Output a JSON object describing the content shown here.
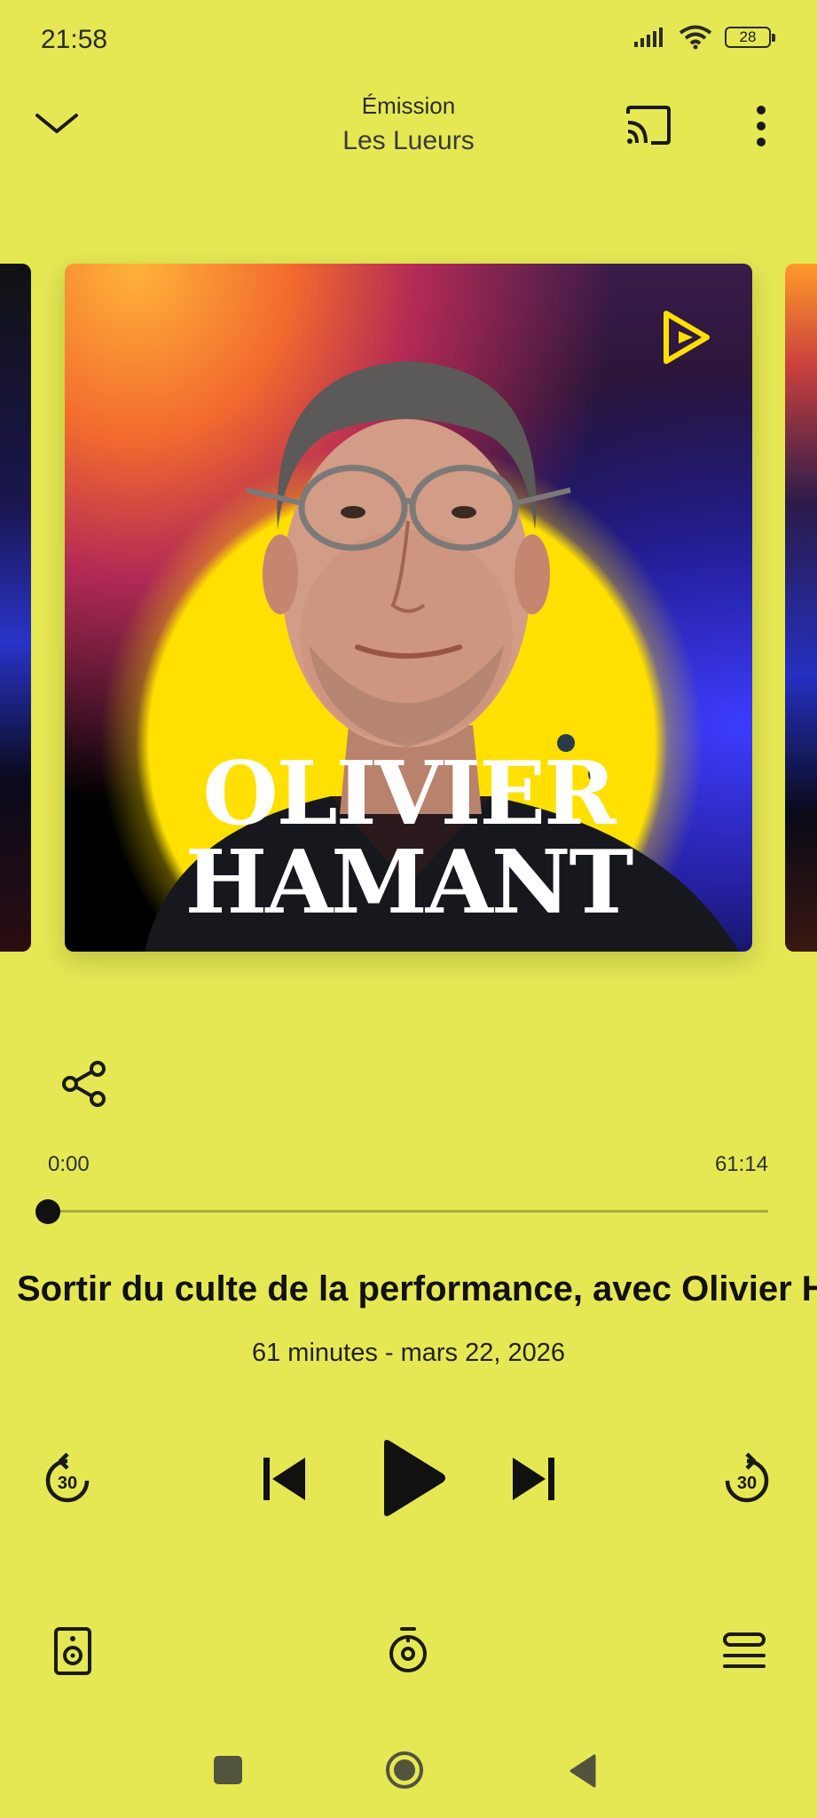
{
  "status_bar": {
    "time": "21:58",
    "battery": "28",
    "icons": [
      "signal-icon",
      "wifi-icon",
      "battery-icon"
    ]
  },
  "header": {
    "subtitle": "Émission",
    "title": "Les Lueurs",
    "icons": [
      "chevron-down-icon",
      "cast-icon",
      "more-vert-icon"
    ]
  },
  "artwork": {
    "name_line1": "OLIVIER",
    "name_line2": "HAMANT",
    "colors": {
      "circle": "#ffe000",
      "logo": "#ffe000"
    }
  },
  "player": {
    "current_time": "0:00",
    "total_time": "61:14",
    "progress": 0,
    "episode_title": "Sortir du culte de la performance, avec Olivier Hamant",
    "episode_meta": "61 minutes - mars 22, 2026",
    "skip_back_label": "30",
    "skip_forward_label": "30"
  },
  "theme": {
    "background": "#e5e853",
    "accent": "#111111"
  }
}
